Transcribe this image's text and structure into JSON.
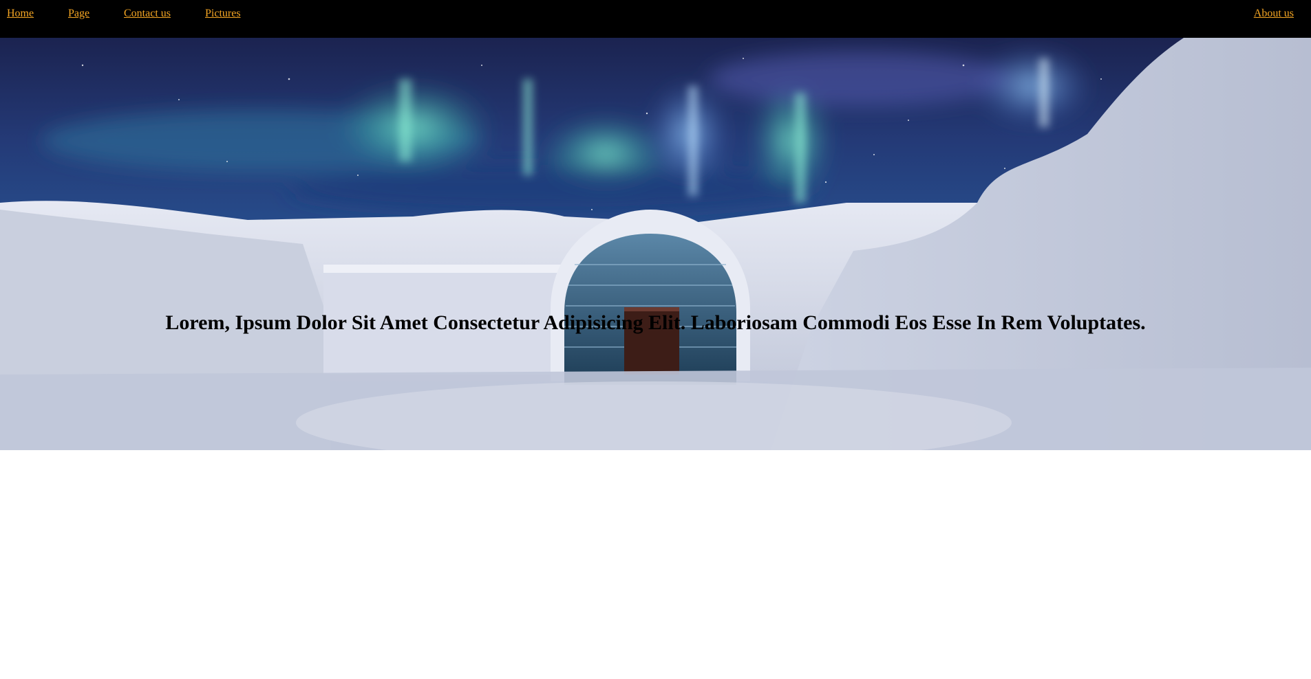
{
  "nav": {
    "links": [
      {
        "label": "Home"
      },
      {
        "label": "Page"
      },
      {
        "label": "Contact us"
      },
      {
        "label": "Pictures"
      }
    ],
    "about_label": "About us",
    "background": "#000000",
    "link_color": "#f5a623"
  },
  "hero": {
    "heading": "Lorem, Ipsum Dolor Sit Amet Consectetur Adipisicing Elit. Laboriosam Commodi Eos Esse In Rem Voluptates.",
    "image_description_icon": "aurora-ice-hotel-photo"
  }
}
